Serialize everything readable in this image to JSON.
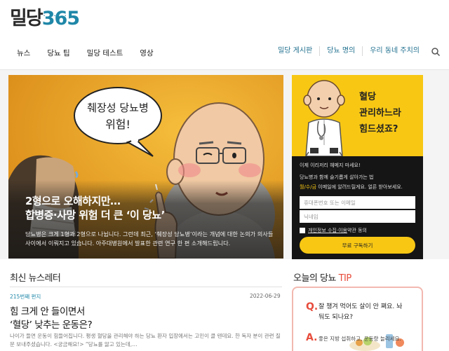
{
  "logo": {
    "text_ko": "밀당",
    "text_num": "365",
    "subtext": "· · ·"
  },
  "nav": {
    "left": [
      "뉴스",
      "당뇨 팁",
      "밀당 테스트",
      "영상"
    ],
    "right": [
      "밀당 게시판",
      "당뇨 명의",
      "우리 동네 주치의"
    ]
  },
  "hero": {
    "bubble_line1": "췌장성 당뇨병",
    "bubble_line2": "위험!",
    "title_line1": "2형으로 오해하지만…",
    "title_line2": "합병증·사망 위험 더 큰 ‘이 당뇨’",
    "description": "당뇨병은 크게 1형과 2형으로 나뉩니다. 그런데 최근, ‘췌장성 당뇨병’이라는 개념에 대한 논의가 의사들 사이에서 이뤄지고 있습니다. 아주대병원에서 발표한 관련 연구 한 편 소개해드립니다."
  },
  "signup": {
    "headline_line1": "혈당",
    "headline_line2": "관리하느라",
    "headline_line3": "힘드셨죠?",
    "line1": "이제 이리저리 헤메지 마세요!",
    "line2": "당뇨병과 함께 슬기롭게 살아가는 법",
    "line3_highlight": "월/수/금",
    "line3_rest": " 이메일에 알려드릴게요. 얼른 받아보세요.",
    "email_placeholder": "휴대폰번호 또는 이메일",
    "name_placeholder": "닉네임",
    "agree_link": "개인정보 수집·이용",
    "agree_rest": " 약관 동의",
    "subscribe_label": "무료 구독하기"
  },
  "newsletter": {
    "section_title": "최신 뉴스레터",
    "issue": "215번째 편지",
    "date": "2022-06-29",
    "title_line1": "힘 크게 안 들이면서",
    "title_line2": "‘혈당’ 낮추는 운동은?",
    "description": "나이가 들면 운동이 힘들어집니다. 평생 혈당을 관리해야 하는 당뇨 환자 입장에서는 고민이 클 텐데요. 한 독자 분이 관련 질문 보내주셨습니다. <궁금해요!> “당뇨를 앓고 있는데,…"
  },
  "tip": {
    "title_prefix": "오늘의 당뇨 ",
    "title_highlight": "TIP",
    "q_mark": "Q.",
    "question_line1": "잘 챙겨 먹어도 살이 안 쪄요. 놔",
    "question_line2": "둬도 되나요?",
    "a_mark": "A.",
    "answer": "좋은 지방 섭취하고, 운동량 늘리세요."
  },
  "colors": {
    "brand": "#1f87a8",
    "accent_yellow": "#f7c714",
    "accent_red": "#e74c3c",
    "hero_bg": "#f0a92a"
  }
}
